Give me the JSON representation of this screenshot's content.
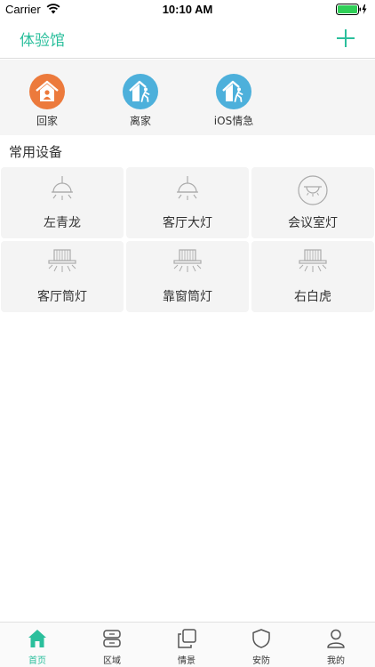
{
  "status": {
    "carrier": "Carrier",
    "time": "10:10 AM"
  },
  "header": {
    "title": "体验馆"
  },
  "scenes": [
    {
      "label": "回家",
      "color": "#ec7a3c",
      "icon": "home-person-icon"
    },
    {
      "label": "离家",
      "color": "#4db0db",
      "icon": "home-leave-icon"
    },
    {
      "label": "iOS情急",
      "color": "#4db0db",
      "icon": "home-leave-icon"
    }
  ],
  "section": {
    "title": "常用设备"
  },
  "devices": [
    {
      "label": "左青龙",
      "icon": "pendant-lamp-icon"
    },
    {
      "label": "客厅大灯",
      "icon": "pendant-lamp-icon"
    },
    {
      "label": "会议室灯",
      "icon": "ceiling-lamp-icon"
    },
    {
      "label": "客厅筒灯",
      "icon": "downlight-icon"
    },
    {
      "label": "靠窗筒灯",
      "icon": "downlight-icon"
    },
    {
      "label": "右白虎",
      "icon": "downlight-icon"
    }
  ],
  "tabs": [
    {
      "label": "首页",
      "icon": "home-icon",
      "active": true
    },
    {
      "label": "区域",
      "icon": "area-icon"
    },
    {
      "label": "情景",
      "icon": "scene-icon"
    },
    {
      "label": "安防",
      "icon": "shield-icon"
    },
    {
      "label": "我的",
      "icon": "user-icon"
    }
  ],
  "colors": {
    "accent": "#2bbf9c",
    "icon_gray": "#aaaaaa"
  }
}
